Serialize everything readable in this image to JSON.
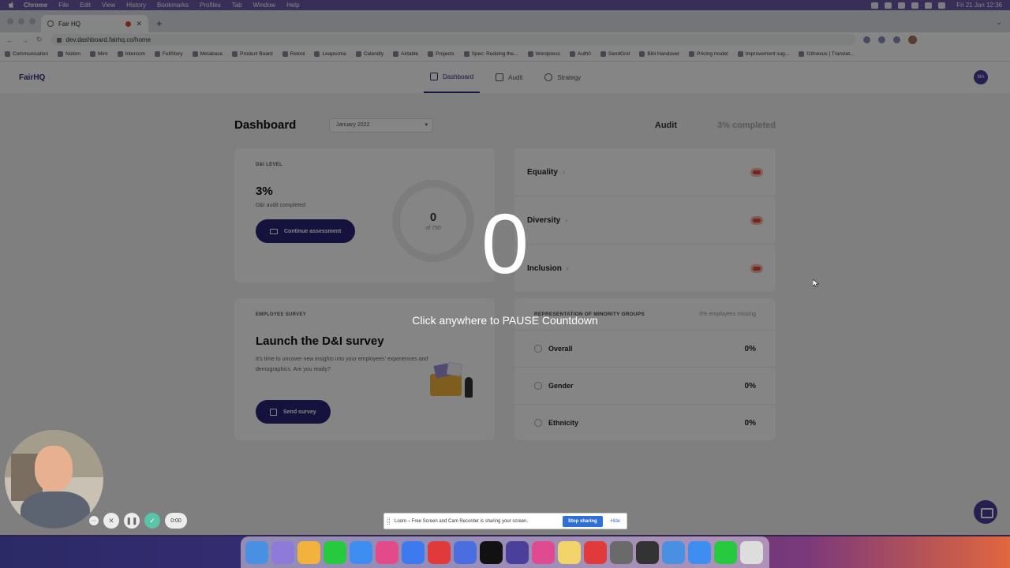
{
  "menubar": {
    "app": "Chrome",
    "items": [
      "File",
      "Edit",
      "View",
      "History",
      "Bookmarks",
      "Profiles",
      "Tab",
      "Window",
      "Help"
    ],
    "clock": "Fri 21 Jan  12:36"
  },
  "browser": {
    "tab_title": "Fair HQ",
    "url": "dev.dashboard.fairhq.co/home",
    "bookmarks": [
      "Communication",
      "Notion",
      "Miro",
      "Intercom",
      "FullStory",
      "Metabase",
      "Product Board",
      "Retool",
      "Leapsome",
      "Calendly",
      "Airtable",
      "Projects",
      "Spec: Redoing the...",
      "Wordpress",
      "Auth0",
      "SendGrid",
      "Bibi Handover",
      "Pricing model",
      "Improvement sug...",
      "I18nexus | Translat..."
    ]
  },
  "app": {
    "logo": "FairHQ",
    "nav": [
      {
        "label": "Dashboard",
        "icon": "home-icon",
        "active": true
      },
      {
        "label": "Audit",
        "icon": "clipboard-icon",
        "active": false
      },
      {
        "label": "Strategy",
        "icon": "target-icon",
        "active": false
      }
    ],
    "avatar_initials": "MA"
  },
  "dashboard": {
    "title": "Dashboard",
    "month": "January 2022",
    "audit_label": "Audit",
    "audit_progress": "3% completed"
  },
  "dni_card": {
    "label": "D&I LEVEL",
    "percent": "3%",
    "sub": "D&I audit completed",
    "button": "Continue assessment",
    "ring_value": "0",
    "ring_of": "of 750"
  },
  "metrics": [
    {
      "name": "Equality",
      "status_color": "#e0473a"
    },
    {
      "name": "Diversity",
      "status_color": "#e0473a"
    },
    {
      "name": "Inclusion",
      "status_color": "#e0473a"
    }
  ],
  "survey_card": {
    "label": "EMPLOYEE SURVEY",
    "title": "Launch the D&I survey",
    "text": "It's time to uncover new insights into your employees' experiences and demographics. Are you ready?",
    "button": "Send survey"
  },
  "representation": {
    "title": "REPRESENTATION OF MINORITY GROUPS",
    "missing": "0% employees missing",
    "rows": [
      {
        "label": "Overall",
        "value": "0%"
      },
      {
        "label": "Gender",
        "value": "0%"
      },
      {
        "label": "Ethnicity",
        "value": "0%"
      }
    ]
  },
  "overlay": {
    "countdown": "0",
    "hint": "Click anywhere to PAUSE Countdown"
  },
  "loom": {
    "timer": "0:00",
    "share_text": "Loom – Free Screen and Cam Recorder is sharing your screen.",
    "stop_label": "Stop sharing",
    "hide_label": "Hide"
  },
  "dock_colors": [
    "#4a90e2",
    "#8e7bd9",
    "#f2b23d",
    "#27c93f",
    "#3d8ef0",
    "#e24a8a",
    "#3d7af0",
    "#e03a3a",
    "#4a6ee0",
    "#111111",
    "#4a3f9a",
    "#e04a90",
    "#f2d46b",
    "#e03a3a",
    "#6a6a6a",
    "#333333",
    "#4a90e2",
    "#3d8ef0",
    "#27c93f",
    "#dddddd"
  ]
}
